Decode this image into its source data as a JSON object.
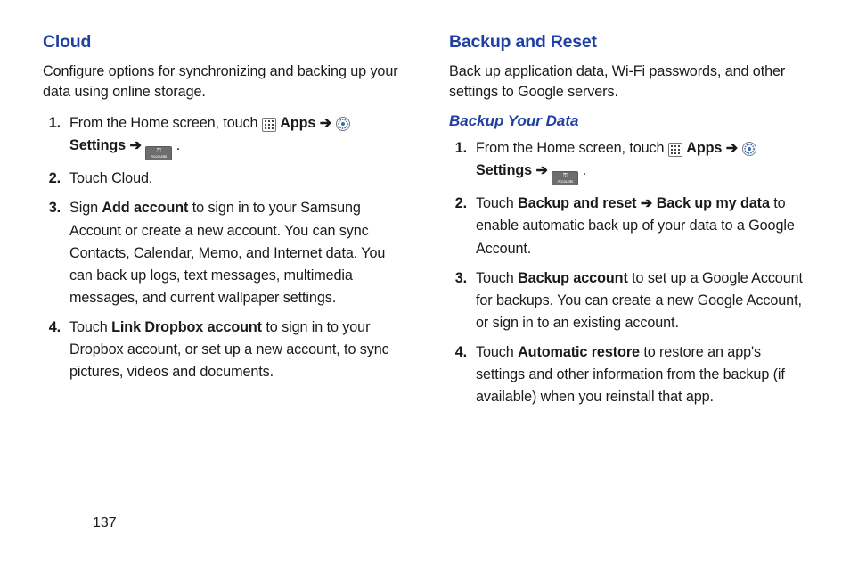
{
  "page_number": "137",
  "left": {
    "heading": "Cloud",
    "intro": "Configure options for synchronizing and backing up your data using online storage.",
    "steps": [
      {
        "n": "1.",
        "pre": "From the Home screen, touch ",
        "apps": "Apps",
        "arrow1": " ➔ ",
        "settings": "Settings",
        "arrow2": " ➔ ",
        "post": "."
      },
      {
        "n": "2.",
        "text": "Touch Cloud."
      },
      {
        "n": "3.",
        "a": "Sign ",
        "bold": "Add account",
        "b": " to sign in to your Samsung Account or create a new account. You can sync Contacts, Calendar, Memo, and Internet data. You can back up logs, text messages, multimedia messages, and current wallpaper settings."
      },
      {
        "n": "4.",
        "a": "Touch ",
        "bold": "Link Dropbox account",
        "b": " to sign in to your Dropbox account, or set up a new account, to sync pictures, videos and documents."
      }
    ]
  },
  "right": {
    "heading": "Backup and Reset",
    "intro": "Back up application data, Wi-Fi passwords, and other settings to Google servers.",
    "subhead": "Backup Your Data",
    "steps": [
      {
        "n": "1.",
        "pre": "From the Home screen, touch ",
        "apps": "Apps",
        "arrow1": " ➔ ",
        "settings": "Settings",
        "arrow2": " ➔ ",
        "post": "."
      },
      {
        "n": "2.",
        "a": "Touch ",
        "bold": "Backup and reset ➔ Back up my data",
        "b": " to enable automatic back up of your data to a Google Account."
      },
      {
        "n": "3.",
        "a": "Touch ",
        "bold": "Backup account",
        "b": " to set up a Google Account for backups. You can create a new Google Account, or sign in to an existing account."
      },
      {
        "n": "4.",
        "a": "Touch ",
        "bold": "Automatic restore",
        "b": " to restore an app's settings and other information from the backup (if available) when you reinstall that app."
      }
    ]
  },
  "icons": {
    "accounts_label": "Accounts"
  }
}
